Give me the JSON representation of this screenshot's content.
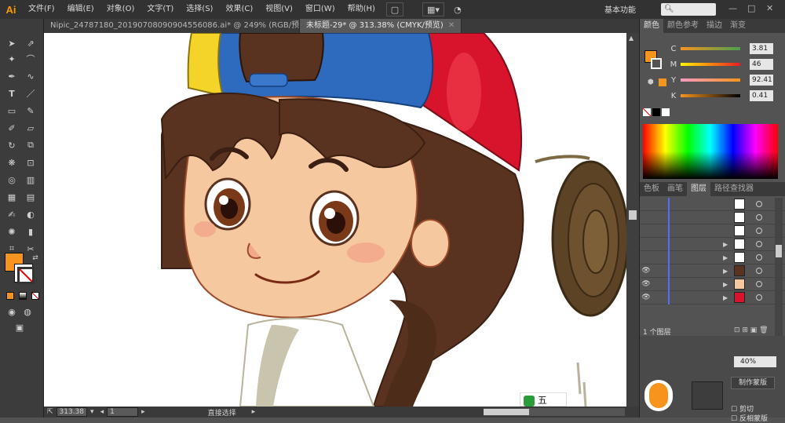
{
  "app": {
    "logo": "Ai"
  },
  "menu": [
    "文件(F)",
    "编辑(E)",
    "对象(O)",
    "文字(T)",
    "选择(S)",
    "效果(C)",
    "视图(V)",
    "窗口(W)",
    "帮助(H)"
  ],
  "workspace": "基本功能",
  "tabs": [
    {
      "label": "Nipic_24787180_20190708090904556086.ai* @ 249% (RGB/预览)",
      "active": false
    },
    {
      "label": "未标题-29* @ 313.38% (CMYK/预览)",
      "active": true
    }
  ],
  "status": {
    "zoom": "313.38",
    "page": "1",
    "tool": "直接选择"
  },
  "color_panel": {
    "tabs": [
      "颜色",
      "颜色参考",
      "描边",
      "渐变"
    ],
    "channels": [
      {
        "label": "C",
        "value": "3.81",
        "color": "#00aeef"
      },
      {
        "label": "M",
        "value": "46",
        "color": "#ec008c"
      },
      {
        "label": "Y",
        "value": "92.41",
        "color": "#fff200"
      },
      {
        "label": "K",
        "value": "0.41",
        "color": "#000000"
      }
    ],
    "fill_color": "#f7941d"
  },
  "layers_panel": {
    "tabs": [
      "色板",
      "画笔",
      "图层",
      "路径查找器"
    ],
    "count_label": "1 个图层"
  },
  "appearance": {
    "button": "制作蒙版",
    "labels": [
      "剪切",
      "反相蒙版"
    ],
    "opacity": "40%"
  },
  "watermark": "五"
}
